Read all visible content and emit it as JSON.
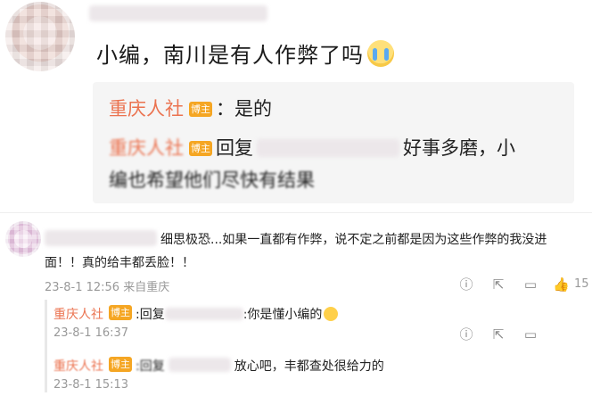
{
  "post": {
    "text": "小编，南川是有人作弊了吗",
    "reply1_name": "重庆人社",
    "reply1_badge": "博主",
    "reply1_text": "：是的",
    "reply2_name": "重庆人社",
    "reply2_badge": "博主",
    "reply2_prefix": "回复",
    "reply2_text_a": "好事多磨，小",
    "reply2_text_b": "编也希望他们尽快有结果"
  },
  "comment": {
    "text_line1": "细思极恐...如果一直都有作弊，说不定之前都是因为这些作弊的我没进",
    "text_line2": "面！！真的给丰都丢脸！！",
    "time": "23-8-1 12:56",
    "location": "来自重庆",
    "like_count": "15"
  },
  "subreplies": [
    {
      "name": "重庆人社",
      "badge": "博主",
      "prefix": ":回复",
      "text": ":你是懂小编的",
      "time": "23-8-1 16:37"
    },
    {
      "name": "重庆人社",
      "badge": "博主",
      "prefix": ":回复",
      "text": "放心吧，丰都查处很给力的",
      "time": "23-8-1 15:13"
    }
  ],
  "icons": [
    "report-icon",
    "share-icon",
    "comment-icon",
    "like-icon"
  ],
  "colors": {
    "name": "#eb7350",
    "badge": "#f5a623",
    "meta": "#999999"
  }
}
